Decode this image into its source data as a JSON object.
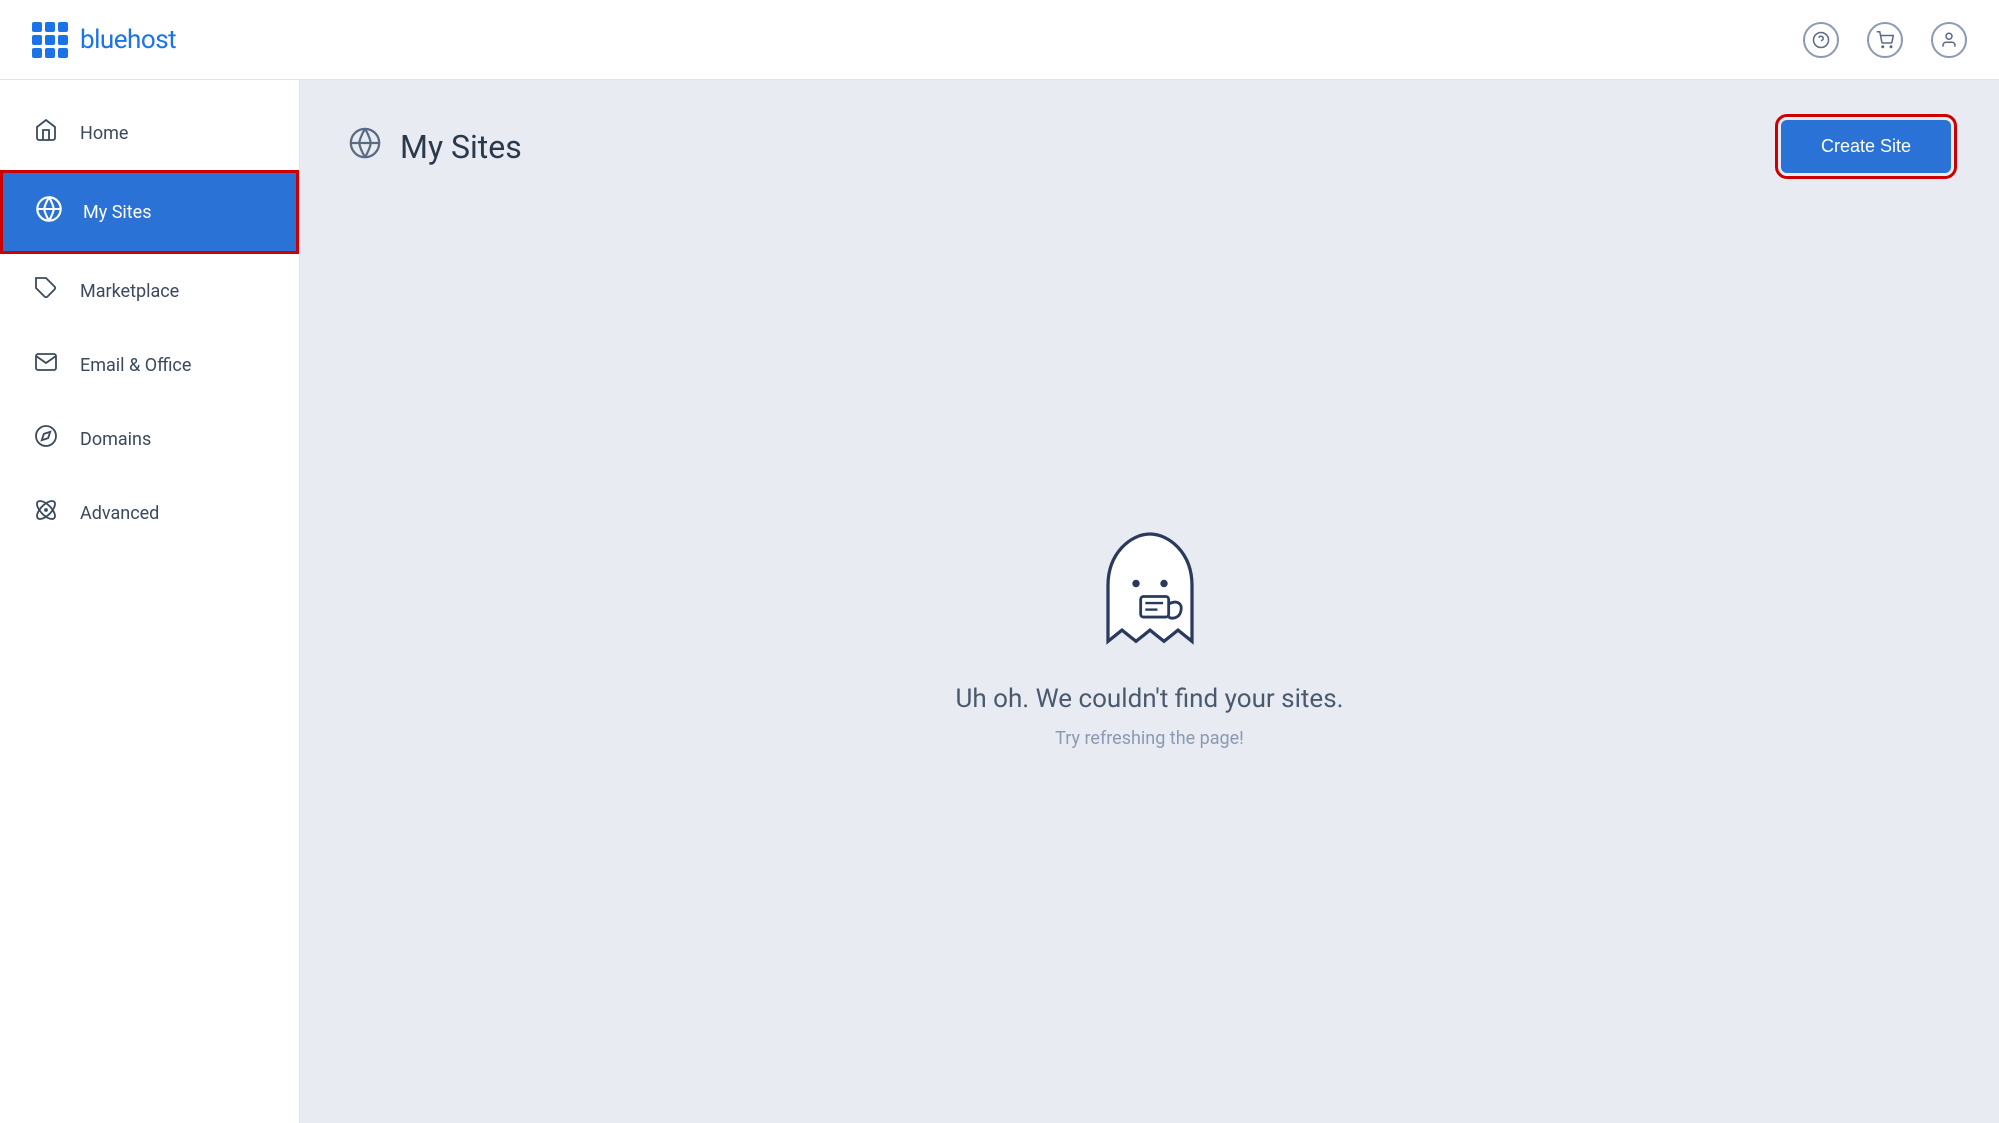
{
  "header": {
    "logo_text": "bluehost",
    "help_icon": "?",
    "cart_icon": "cart",
    "user_icon": "user"
  },
  "sidebar": {
    "items": [
      {
        "id": "home",
        "label": "Home",
        "icon": "home",
        "active": false
      },
      {
        "id": "my-sites",
        "label": "My Sites",
        "icon": "wordpress",
        "active": true
      },
      {
        "id": "marketplace",
        "label": "Marketplace",
        "icon": "tag",
        "active": false
      },
      {
        "id": "email-office",
        "label": "Email & Office",
        "icon": "mail",
        "active": false
      },
      {
        "id": "domains",
        "label": "Domains",
        "icon": "compass",
        "active": false
      },
      {
        "id": "advanced",
        "label": "Advanced",
        "icon": "atom",
        "active": false
      }
    ]
  },
  "main": {
    "page_title": "My Sites",
    "create_site_label": "Create Site",
    "empty_state": {
      "title": "Uh oh. We couldn't find your sites.",
      "subtitle": "Try refreshing the page!"
    }
  },
  "colors": {
    "active_bg": "#2a72d5",
    "highlight_red": "#cc0000",
    "create_btn_bg": "#2a72d5"
  }
}
